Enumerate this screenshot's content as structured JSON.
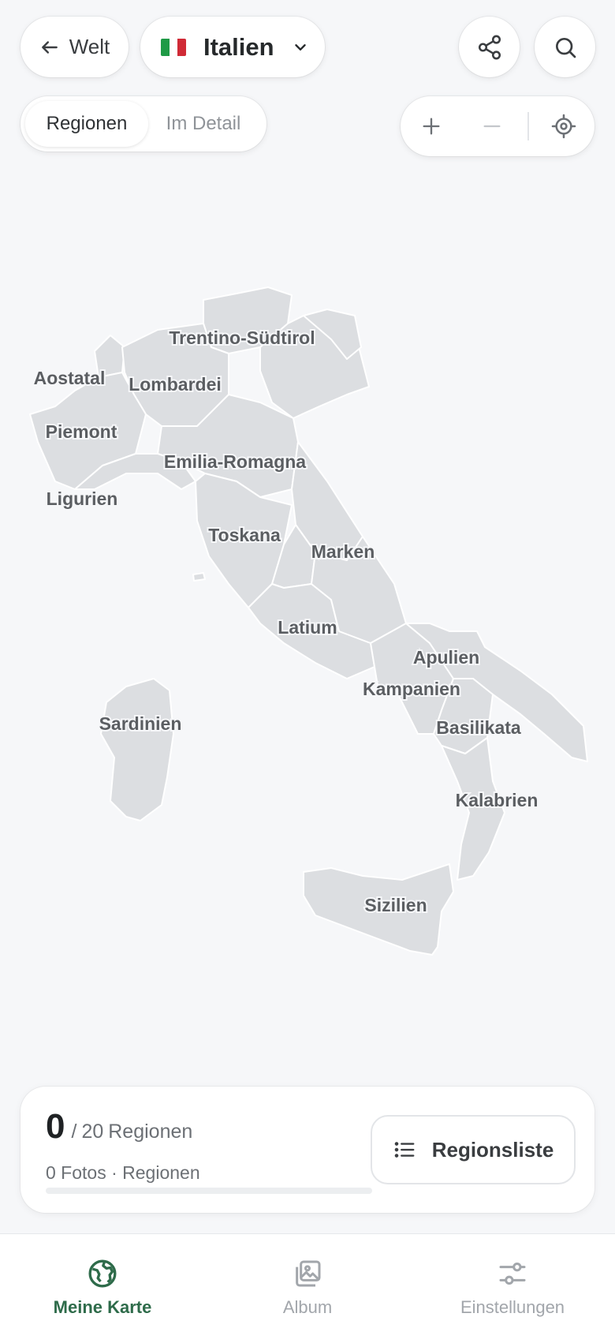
{
  "header": {
    "back_label": "Welt",
    "country_name": "Italien",
    "flag_colors": [
      "#1f9a46",
      "#ffffff",
      "#d02a36"
    ]
  },
  "mode_toggle": {
    "active_label": "Regionen",
    "inactive_label": "Im Detail"
  },
  "map": {
    "regions": [
      {
        "id": "trentino",
        "label": "Trentino-Südtirol"
      },
      {
        "id": "aostatal",
        "label": "Aostatal"
      },
      {
        "id": "lombardei",
        "label": "Lombardei"
      },
      {
        "id": "piemont",
        "label": "Piemont"
      },
      {
        "id": "emilia",
        "label": "Emilia-Romagna"
      },
      {
        "id": "ligurien",
        "label": "Ligurien"
      },
      {
        "id": "toskana",
        "label": "Toskana"
      },
      {
        "id": "marken",
        "label": "Marken"
      },
      {
        "id": "latium",
        "label": "Latium"
      },
      {
        "id": "apulien",
        "label": "Apulien"
      },
      {
        "id": "kampanien",
        "label": "Kampanien"
      },
      {
        "id": "sardinien",
        "label": "Sardinien"
      },
      {
        "id": "basilikata",
        "label": "Basilikata"
      },
      {
        "id": "kalabrien",
        "label": "Kalabrien"
      },
      {
        "id": "sizilien",
        "label": "Sizilien"
      }
    ]
  },
  "stats": {
    "visited_count": "0",
    "separator": "/",
    "total": "20",
    "unit": "Regionen",
    "subline": "0 Fotos · Regionen",
    "progress_fraction": 0,
    "list_button_label": "Regionsliste"
  },
  "tabbar": {
    "tabs": [
      {
        "label": "Meine Karte",
        "icon": "globe-icon",
        "active": true
      },
      {
        "label": "Album",
        "icon": "photos-icon",
        "active": false
      },
      {
        "label": "Einstellungen",
        "icon": "sliders-icon",
        "active": false
      }
    ]
  },
  "colors": {
    "accent": "#2e6b4a",
    "region_fill": "#dcdee1",
    "background": "#f6f7f9"
  }
}
